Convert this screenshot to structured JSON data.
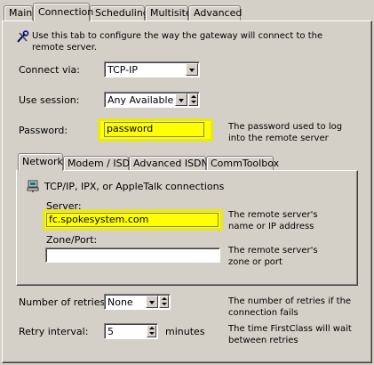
{
  "tabs": [
    "Main",
    "Connection",
    "Scheduling",
    "Multisite",
    "Advanced"
  ],
  "intro": {
    "icon": "wrench-pencil-icon",
    "text": "Use this tab to configure the way the gateway will connect to the remote server."
  },
  "connect_via": {
    "label": "Connect via:",
    "value": "TCP-IP"
  },
  "use_session": {
    "label": "Use session:",
    "value": "Any Available"
  },
  "password": {
    "label": "Password:",
    "value": "password",
    "desc": "The password used to log into the remote server"
  },
  "inner_tabs": [
    "Network",
    "Modem / ISDN",
    "Advanced ISDN",
    "CommToolbox"
  ],
  "network": {
    "icon": "network-computer-icon",
    "heading": "TCP/IP, IPX, or AppleTalk connections",
    "server": {
      "label": "Server:",
      "value": "fc.spokesystem.com",
      "desc": "The remote server's name or IP address"
    },
    "zone_port": {
      "label": "Zone/Port:",
      "value": "",
      "desc": "The remote server's zone or port"
    }
  },
  "retries": {
    "label": "Number of retries:",
    "value": "None",
    "desc": "The number of retries if the connection fails"
  },
  "retry_interval": {
    "label": "Retry interval:",
    "value": "5",
    "unit": "minutes",
    "desc": "The time FirstClass will wait between retries"
  },
  "colors": {
    "highlight": "#ffff00",
    "window": "#d4d0c8"
  }
}
